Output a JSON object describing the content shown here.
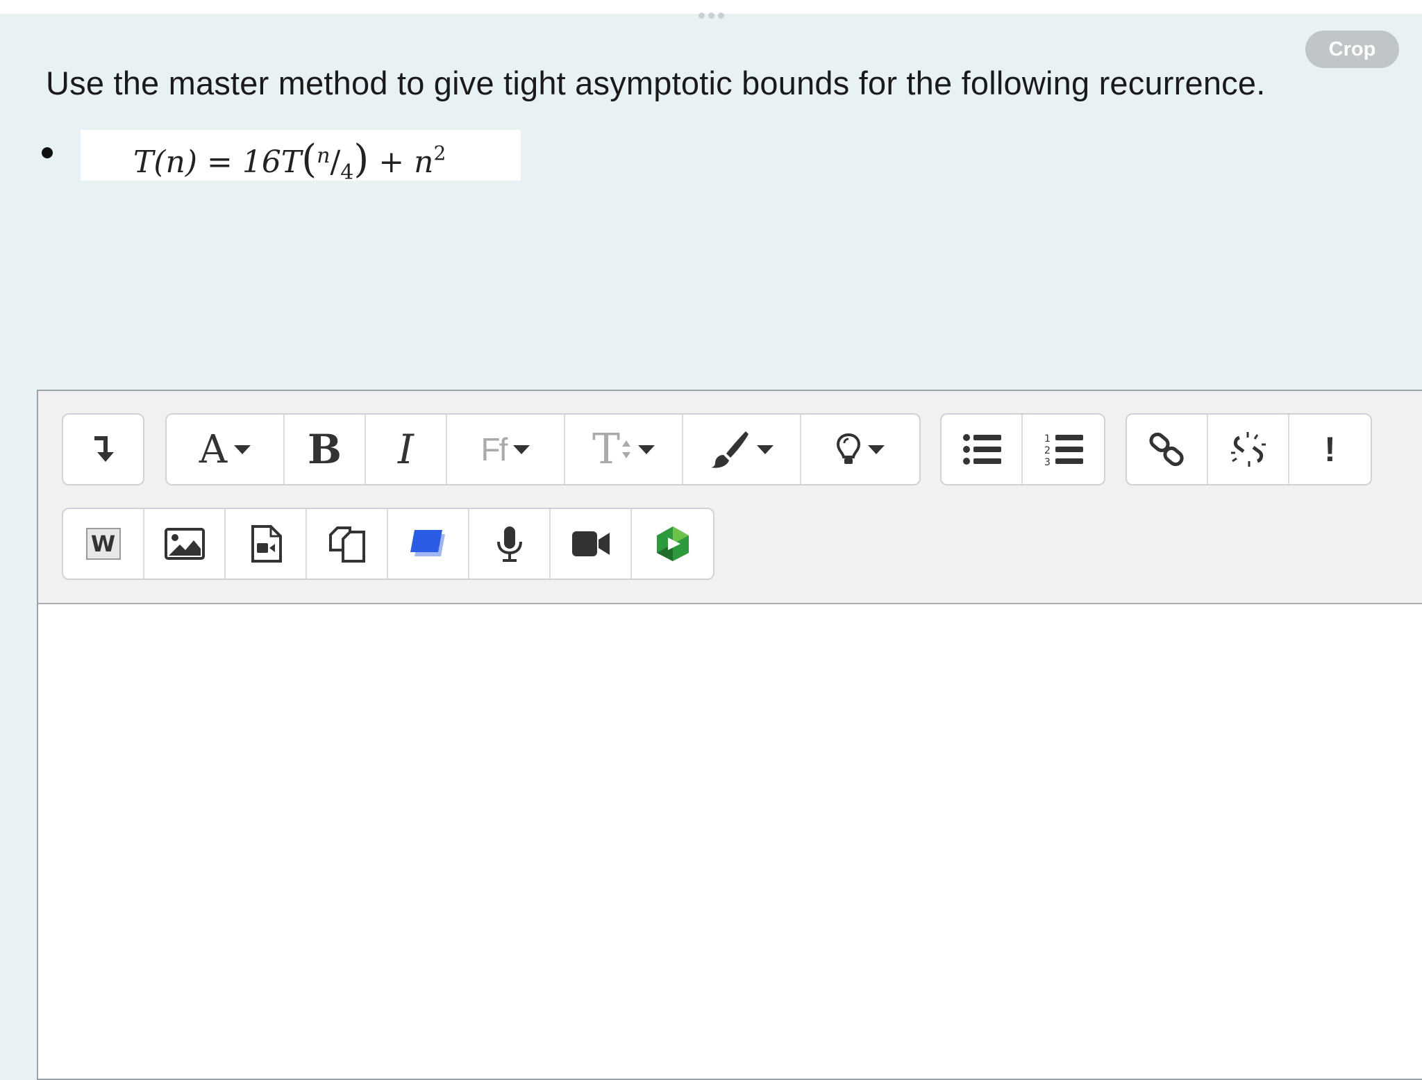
{
  "crop_label": "Crop",
  "question": "Use the master method to give tight asymptotic bounds for the following recurrence.",
  "formula": {
    "lhs": "T(n)",
    "equals": "=",
    "coef": "16T",
    "open": "(",
    "num": "n",
    "slash": "/",
    "den": "4",
    "close": ")",
    "plus": "+",
    "term": "n",
    "exp": "2"
  },
  "toolbar": {
    "row1": {
      "group1": [
        {
          "name": "collapse-toggle",
          "icon": "arrow-down-icon"
        }
      ],
      "group2": [
        {
          "name": "font-color",
          "glyph": "A",
          "dropdown": true
        },
        {
          "name": "bold",
          "glyph": "B"
        },
        {
          "name": "italic",
          "glyph": "I"
        },
        {
          "name": "font-family",
          "glyph": "Ff",
          "dropdown": true
        },
        {
          "name": "font-size",
          "glyph": "T",
          "dropdown": true
        },
        {
          "name": "brush",
          "icon": "paintbrush-icon",
          "dropdown": true
        },
        {
          "name": "accessibility-helper",
          "icon": "lightbulb-icon",
          "dropdown": true
        }
      ],
      "group3": [
        {
          "name": "unordered-list",
          "icon": "bullet-list-icon"
        },
        {
          "name": "ordered-list",
          "icon": "numbered-list-icon"
        }
      ],
      "group4": [
        {
          "name": "link",
          "icon": "link-icon"
        },
        {
          "name": "unlink",
          "icon": "unlink-icon"
        },
        {
          "name": "accessibility-checker",
          "glyph": "!"
        }
      ]
    },
    "row2": [
      {
        "name": "word-import",
        "glyph": "W"
      },
      {
        "name": "insert-image",
        "icon": "image-icon"
      },
      {
        "name": "insert-media",
        "icon": "media-file-icon"
      },
      {
        "name": "manage-files",
        "icon": "copy-files-icon"
      },
      {
        "name": "h5p",
        "icon": "blue-square-icon"
      },
      {
        "name": "record-audio",
        "icon": "microphone-icon"
      },
      {
        "name": "record-video",
        "icon": "video-camera-icon"
      },
      {
        "name": "panopto",
        "icon": "green-play-icon"
      }
    ]
  },
  "colors": {
    "background": "#e8f2f4",
    "toolbar_bg": "#f1f1f1",
    "crop_button": "#c0c6c8",
    "h5p_blue": "#2b5ce6",
    "panopto_green": "#2e9a3e"
  }
}
